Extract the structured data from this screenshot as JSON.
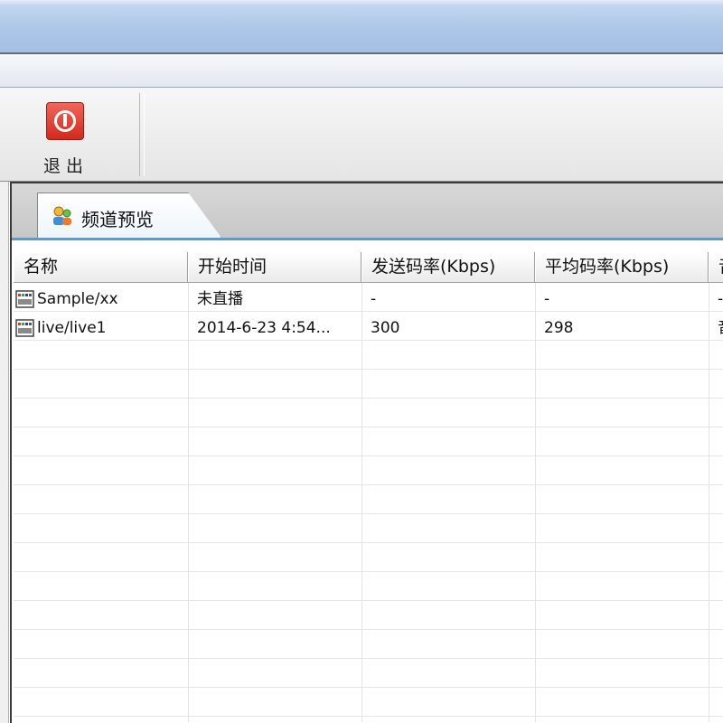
{
  "toolbar": {
    "exit_label": "退出"
  },
  "tab": {
    "label": "频道预览",
    "icon": "channel-preview-icon"
  },
  "table": {
    "columns": [
      "名称",
      "开始时间",
      "发送码率(Kbps)",
      "平均码率(Kbps)",
      "音"
    ],
    "rows": [
      {
        "name": "Sample/xx",
        "start_time": "未直播",
        "send_bitrate": "-",
        "avg_bitrate": "-",
        "extra": "-"
      },
      {
        "name": "live/live1",
        "start_time": "2014-6-23 4:54...",
        "send_bitrate": "300",
        "avg_bitrate": "298",
        "extra": "音"
      }
    ]
  },
  "colors": {
    "accent": "#4aa0e6",
    "exit_red": "#d12a1c"
  }
}
